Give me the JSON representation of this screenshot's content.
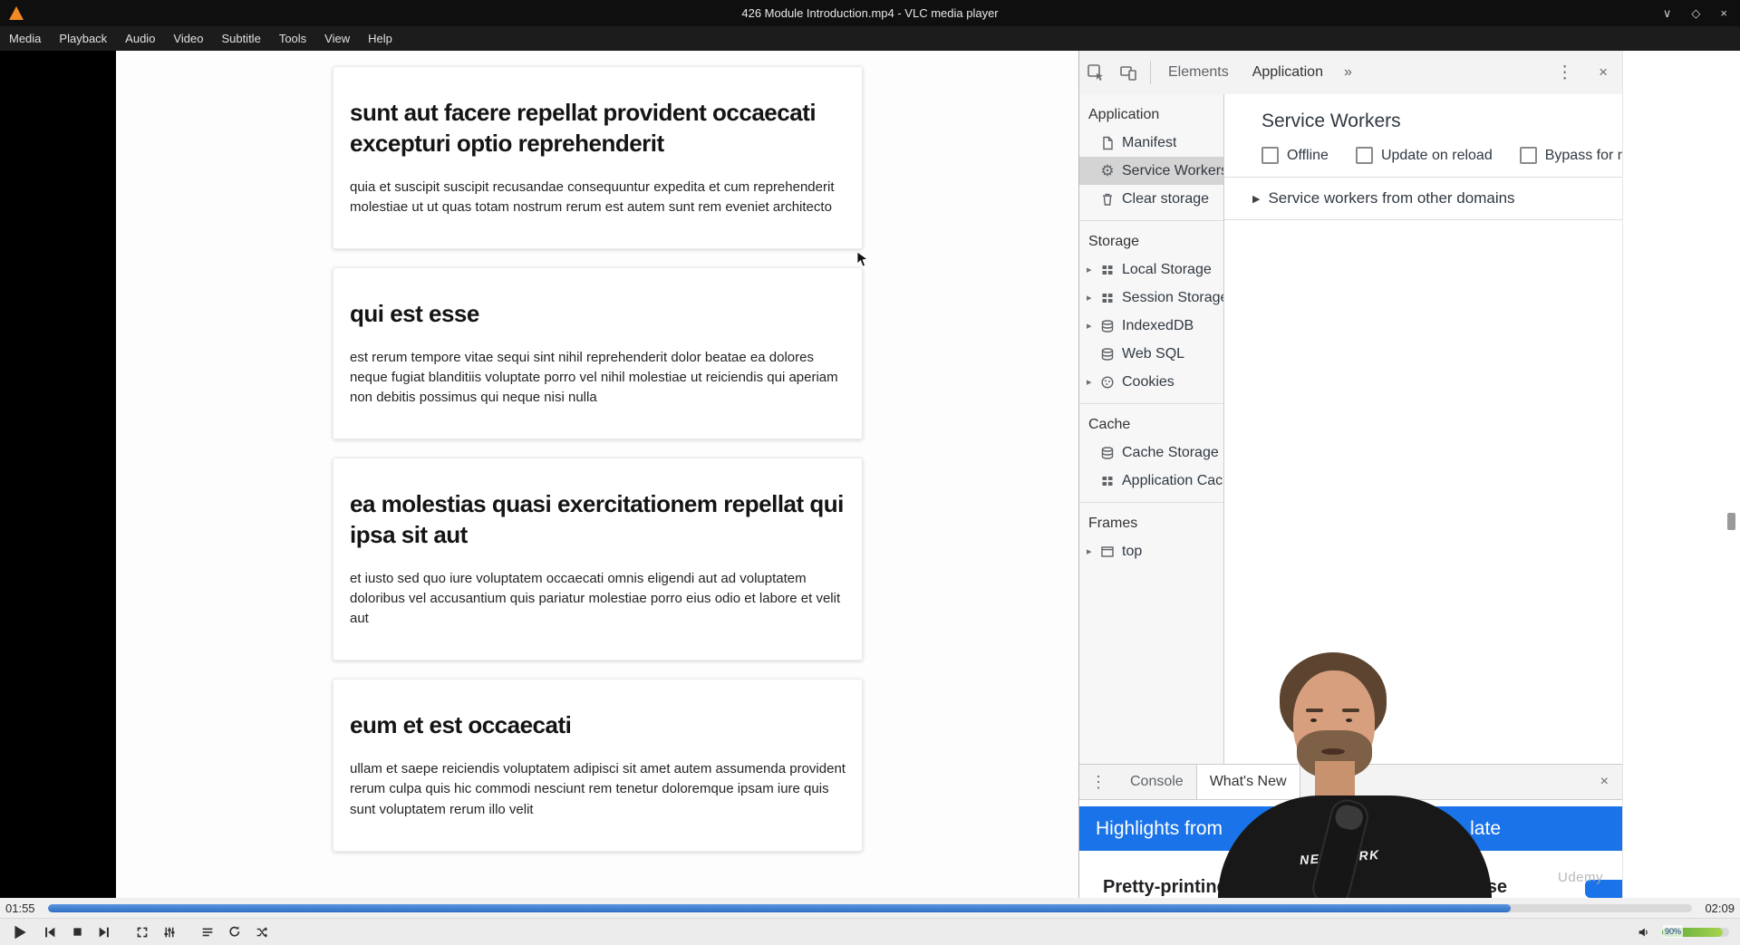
{
  "window": {
    "title": "426 Module Introduction.mp4 - VLC media player",
    "minimize_glyph": "∨",
    "maximize_glyph": "◇",
    "close_glyph": "×"
  },
  "menu": {
    "items": [
      "Media",
      "Playback",
      "Audio",
      "Video",
      "Subtitle",
      "Tools",
      "View",
      "Help"
    ]
  },
  "page": {
    "posts": [
      {
        "title": "sunt aut facere repellat provident occaecati excepturi optio reprehenderit",
        "body": "quia et suscipit suscipit recusandae consequuntur expedita et cum reprehenderit molestiae ut ut quas totam nostrum rerum est autem sunt rem eveniet architecto"
      },
      {
        "title": "qui est esse",
        "body": "est rerum tempore vitae sequi sint nihil reprehenderit dolor beatae ea dolores neque fugiat blanditiis voluptate porro vel nihil molestiae ut reiciendis qui aperiam non debitis possimus qui neque nisi nulla"
      },
      {
        "title": "ea molestias quasi exercitationem repellat qui ipsa sit aut",
        "body": "et iusto sed quo iure voluptatem occaecati omnis eligendi aut ad voluptatem doloribus vel accusantium quis pariatur molestiae porro eius odio et labore et velit aut"
      },
      {
        "title": "eum et est occaecati",
        "body": "ullam et saepe reiciendis voluptatem adipisci sit amet autem assumenda provident rerum culpa quis hic commodi nesciunt rem tenetur doloremque ipsam iure quis sunt voluptatem rerum illo velit"
      }
    ]
  },
  "devtools": {
    "toolbar": {
      "elements_tab": "Elements",
      "application_tab": "Application",
      "more_glyph": "»",
      "kebab_glyph": "⋮",
      "close_glyph": "×"
    },
    "sidebar": {
      "arrow_glyph": "▸",
      "gear_glyph": "⚙",
      "sections": [
        {
          "title": "Application",
          "items": [
            {
              "label": "Manifest"
            },
            {
              "label": "Service Workers"
            },
            {
              "label": "Clear storage"
            }
          ]
        },
        {
          "title": "Storage",
          "items": [
            {
              "label": "Local Storage"
            },
            {
              "label": "Session Storage"
            },
            {
              "label": "IndexedDB"
            },
            {
              "label": "Web SQL"
            },
            {
              "label": "Cookies"
            }
          ]
        },
        {
          "title": "Cache",
          "items": [
            {
              "label": "Cache Storage"
            },
            {
              "label": "Application Cache"
            }
          ]
        },
        {
          "title": "Frames",
          "items": [
            {
              "label": "top"
            }
          ]
        }
      ]
    },
    "main": {
      "title": "Service Workers",
      "offline_label": "Offline",
      "update_label": "Update on reload",
      "bypass_label": "Bypass for network",
      "arrow_glyph": "▶",
      "other_domains_label": "Service workers from other domains"
    },
    "drawer": {
      "kebab_glyph": "⋮",
      "console_tab": "Console",
      "whats_new_tab": "What's New",
      "close_glyph": "×",
      "banner_left": "Highlights from",
      "banner_right": "late",
      "article_left": "Pretty-printing",
      "article_right": "se"
    }
  },
  "webcam": {
    "shirt_text": "NEW YORK"
  },
  "watermark": "Udemy",
  "player": {
    "elapsed": "01:55",
    "duration": "02:09",
    "progress_pct": 89,
    "volume_pct": 90,
    "volume_label": "90%"
  },
  "colors": {
    "accent_blue": "#1a73e8",
    "seek_blue": "#2f6fc4",
    "volume_green": "#57a639"
  }
}
